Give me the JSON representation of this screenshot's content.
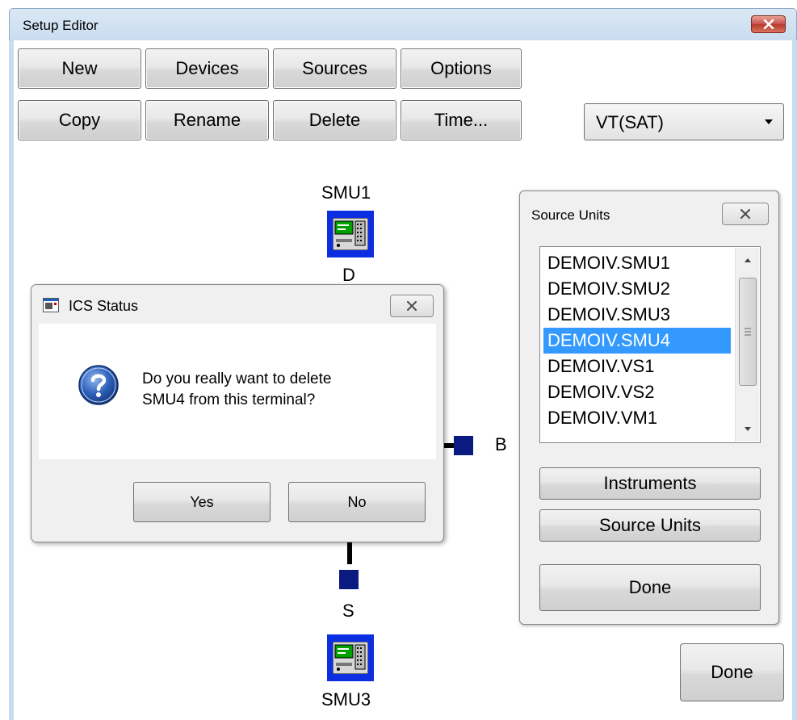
{
  "window": {
    "title": "Setup Editor"
  },
  "toolbar": {
    "row1": [
      "New",
      "Devices",
      "Sources",
      "Options"
    ],
    "row2": [
      "Copy",
      "Rename",
      "Delete",
      "Time..."
    ]
  },
  "script_select": {
    "value": "VT(SAT)"
  },
  "circuit": {
    "top_unit": "SMU1",
    "drain_label": "D",
    "bulk_label": "B",
    "source_label": "S",
    "bottom_unit": "SMU3"
  },
  "source_units_panel": {
    "title": "Source Units",
    "items": [
      "DEMOIV.SMU1",
      "DEMOIV.SMU2",
      "DEMOIV.SMU3",
      "DEMOIV.SMU4",
      "DEMOIV.VS1",
      "DEMOIV.VS2",
      "DEMOIV.VM1"
    ],
    "selected_item": "DEMOIV.SMU4",
    "instruments_button": "Instruments",
    "source_units_button": "Source Units",
    "done_button": "Done"
  },
  "main_done_button": "Done",
  "dialog": {
    "title": "ICS Status",
    "message_line1": "Do you really want to delete",
    "message_line2": "SMU4 from this terminal?",
    "yes_button": "Yes",
    "no_button": "No"
  }
}
